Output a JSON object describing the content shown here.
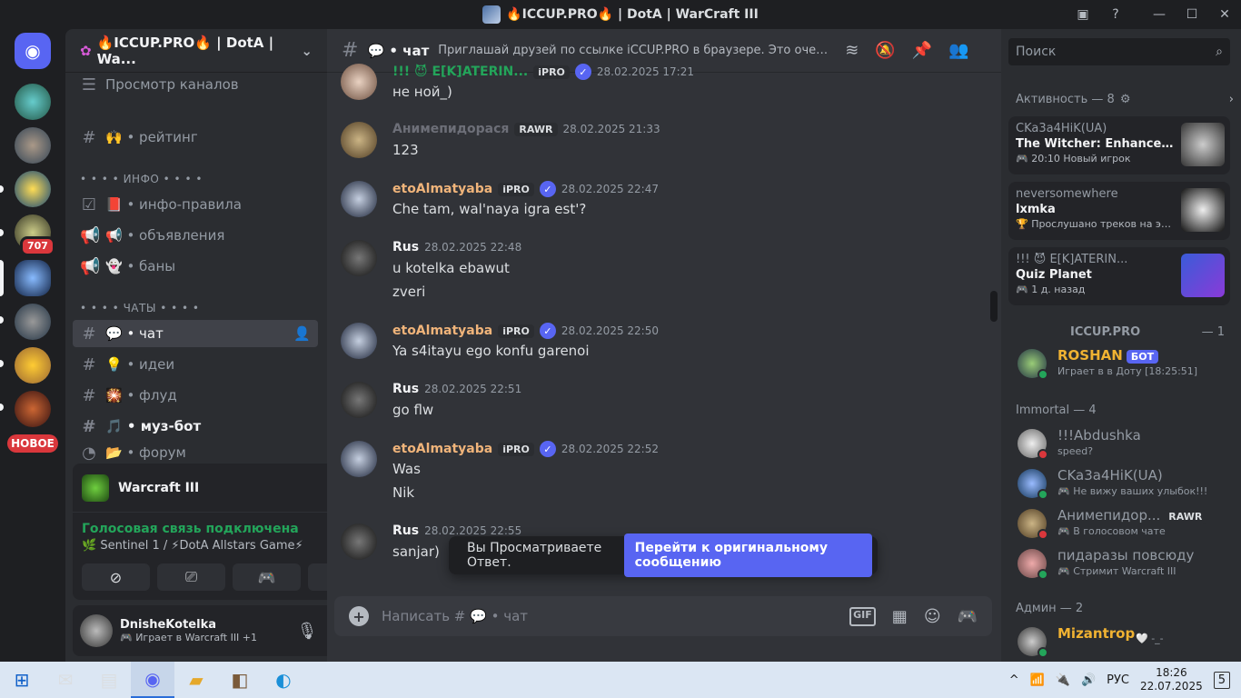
{
  "window": {
    "title": "🔥ICCUP.PRO🔥 | DotA | WarCraft III"
  },
  "rail": {
    "mention_badge": "707",
    "new_label": "НОВОЕ"
  },
  "server": {
    "name": "🔥ICCUP.PRO🔥 | DotA | Wa..."
  },
  "channels": {
    "browse": "Просмотр каналов",
    "rating": "🙌 • рейтинг",
    "cat_info": "• • • • ИНФО • • • •",
    "info_rules": "📕 • инфо-правила",
    "announcements": "📢 • объявления",
    "bans": "👻 • баны",
    "cat_chats": "• • • • ЧАТЫ • • • •",
    "chat": "💬 • чат",
    "ideas": "💡 • идеи",
    "flood": "🎇 • флуд",
    "music": "🎵 • муз-бот",
    "forum": "📂 • форум"
  },
  "voice": {
    "game": "Warcraft III",
    "connected": "Голосовая связь подключена",
    "channel": "🌿 Sentinel 1 / ⚡DotA Allstars Game⚡"
  },
  "user": {
    "name": "DnisheKotelka",
    "status": "🎮 Играет в Warcraft III +1"
  },
  "chat_header": {
    "name": "💬 • чат",
    "topic": "Приглашай друзей по ссылке iCCUP.PRO в браузере. Это очень п..."
  },
  "messages": [
    {
      "name": "!!! 😈 E[K]ATERIN...",
      "tag": "iPRO",
      "time": "28.02.2025 17:21",
      "lines": [
        "не ной_)"
      ]
    },
    {
      "name": "Анимепидорася",
      "tag": "RAWR",
      "time": "28.02.2025 21:33",
      "lines": [
        "123"
      ]
    },
    {
      "name": "etoAlmatyaba",
      "tag": "iPRO",
      "time": "28.02.2025 22:47",
      "lines": [
        "Che tam, wal'naya igra est'?"
      ]
    },
    {
      "name": "Rus",
      "tag": "",
      "time": "28.02.2025 22:48",
      "lines": [
        "u kotelka ebawut",
        "zveri"
      ]
    },
    {
      "name": "etoAlmatyaba",
      "tag": "iPRO",
      "time": "28.02.2025 22:50",
      "lines": [
        "Ya s4itayu ego konfu garenoi"
      ]
    },
    {
      "name": "Rus",
      "tag": "",
      "time": "28.02.2025 22:51",
      "lines": [
        "go flw"
      ]
    },
    {
      "name": "etoAlmatyaba",
      "tag": "iPRO",
      "time": "28.02.2025 22:52",
      "lines": [
        "Was",
        "Nik"
      ]
    },
    {
      "name": "Rus",
      "tag": "",
      "time": "28.02.2025 22:55",
      "lines": [
        "sanjar)"
      ]
    }
  ],
  "toast": {
    "text": "Вы Просматриваете Ответ.",
    "button": "Перейти к оригинальному сообщению"
  },
  "composer": {
    "placeholder": "Написать #  💬 • чат"
  },
  "right": {
    "search_placeholder": "Поиск",
    "activity_title": "Активность — 8",
    "cards": [
      {
        "who": "CKa3a4HiK(UA)",
        "what": "The Witcher: Enhanced Edi...",
        "sub": "🎮 20:10  Новый игрок"
      },
      {
        "who": "neversomewhere",
        "what": "lxmka",
        "sub": "🏆 Прослушано треков на этой..."
      },
      {
        "who": "!!! 😈 E[K]ATERIN...",
        "what": "Quiz Planet",
        "sub": "🎮 1 д. назад"
      }
    ],
    "roles": [
      {
        "name": "ICCUP.PRO",
        "count": "— 1"
      },
      {
        "name": "Immortal — 4",
        "count": ""
      },
      {
        "name": "Админ — 2",
        "count": ""
      }
    ],
    "members": [
      {
        "name": "ROSHAN",
        "badge": "БОТ",
        "status": "Играет в в Доту [18:25:51]"
      },
      {
        "name": "!!!Abdushka",
        "status": "speed?"
      },
      {
        "name": "CKa3a4HiK(UA)",
        "status": "🎮 Не вижу ваших улыбок!!!"
      },
      {
        "name": "Анимепидор...",
        "badge": "RAWR",
        "status": "🎮 В голосовом чате"
      },
      {
        "name": "пидаразы повсюду",
        "status": "🎮 Стримит Warcraft III"
      },
      {
        "name": "Mizantrop",
        "status": "🤍 -_-"
      }
    ]
  },
  "taskbar": {
    "lang": "РУС",
    "time": "18:26",
    "date": "22.07.2025",
    "notif": "5"
  }
}
